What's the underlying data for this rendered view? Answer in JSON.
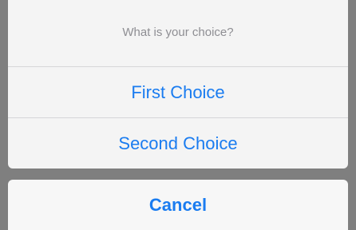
{
  "action_sheet": {
    "title": "What is your choice?",
    "options": [
      {
        "label": "First Choice"
      },
      {
        "label": "Second Choice"
      }
    ],
    "cancel_label": "Cancel"
  },
  "colors": {
    "background_dim": "#7f7f7f",
    "sheet_background": "#f4f4f4",
    "title_text": "#8e8e93",
    "action_text": "#1a7cf0",
    "separator": "#d6d6d8"
  }
}
